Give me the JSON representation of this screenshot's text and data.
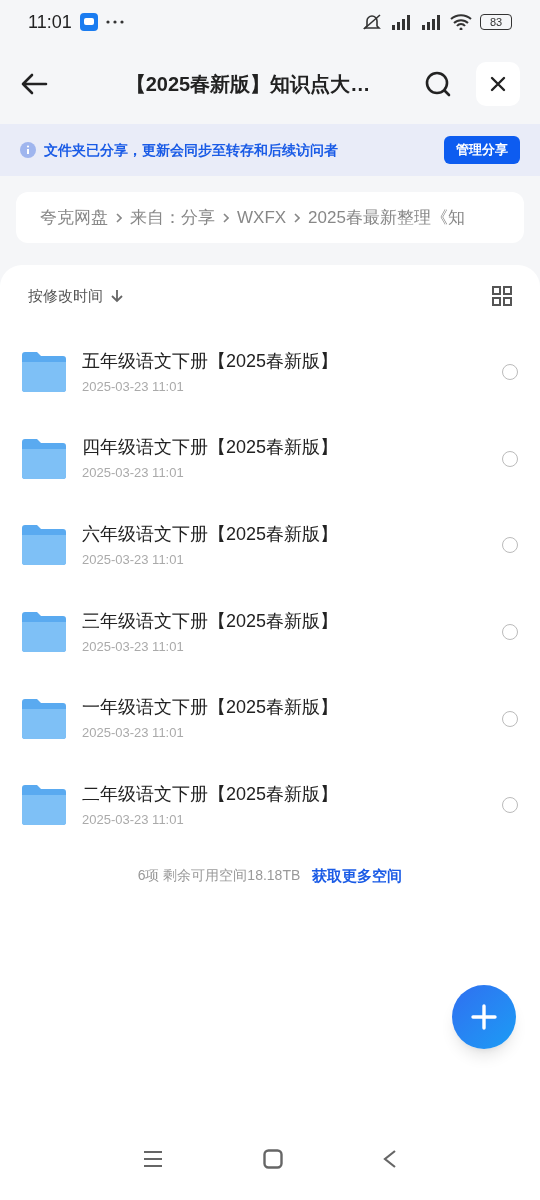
{
  "status_bar": {
    "time": "11:01",
    "battery": "83"
  },
  "header": {
    "title": "【2025春新版】知识点大…"
  },
  "banner": {
    "text": "文件夹已分享，更新会同步至转存和后续访问者",
    "button": "管理分享"
  },
  "breadcrumb": [
    "夸克网盘",
    "来自：分享",
    "WXFX",
    "2025春最新整理《知"
  ],
  "sort": {
    "label": "按修改时间"
  },
  "files": [
    {
      "name": "五年级语文下册【2025春新版】",
      "date": "2025-03-23 11:01",
      "selected": false
    },
    {
      "name": "四年级语文下册【2025春新版】",
      "date": "2025-03-23 11:01",
      "selected": false
    },
    {
      "name": "六年级语文下册【2025春新版】",
      "date": "2025-03-23 11:01",
      "selected": false
    },
    {
      "name": "三年级语文下册【2025春新版】",
      "date": "2025-03-23 11:01",
      "selected": false
    },
    {
      "name": "一年级语文下册【2025春新版】",
      "date": "2025-03-23 11:01",
      "selected": false
    },
    {
      "name": "二年级语文下册【2025春新版】",
      "date": "2025-03-23 11:01",
      "selected": false
    }
  ],
  "footer": {
    "text": "6项 剩余可用空间18.18TB",
    "link": "获取更多空间"
  }
}
